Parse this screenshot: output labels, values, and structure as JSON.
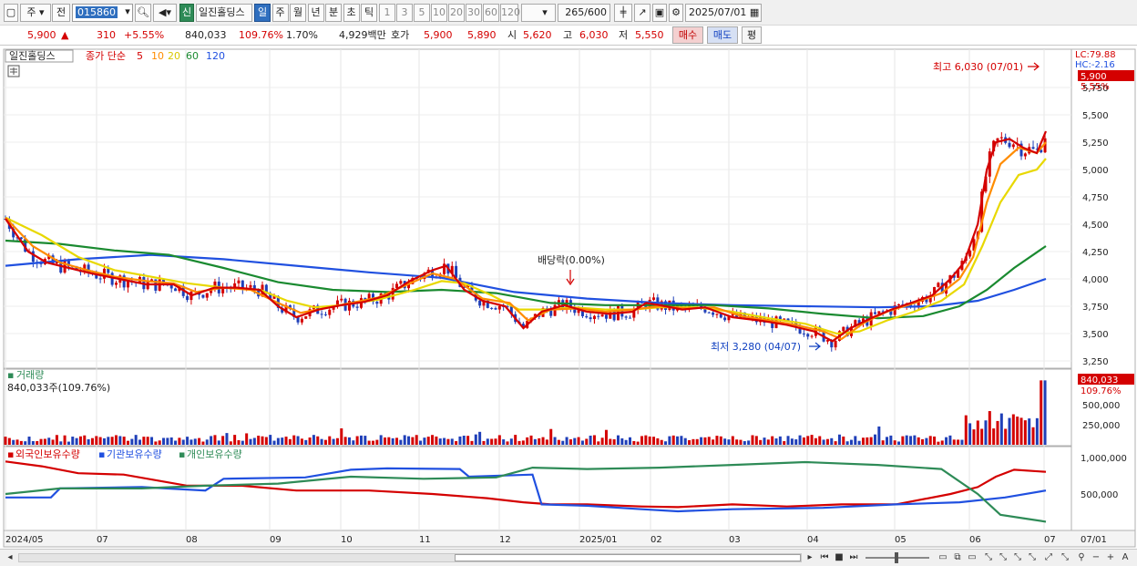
{
  "toolbar": {
    "type_label": "주",
    "prev_label": "전",
    "stock_code": "015860",
    "new_label": "신",
    "stock_name": "일진홀딩스",
    "period_tabs": [
      {
        "label": "일",
        "active": true
      },
      {
        "label": "주",
        "active": false
      },
      {
        "label": "월",
        "active": false
      },
      {
        "label": "년",
        "active": false
      },
      {
        "label": "분",
        "active": false
      },
      {
        "label": "초",
        "active": false
      },
      {
        "label": "틱",
        "active": false
      }
    ],
    "intervals": [
      "1",
      "3",
      "5",
      "10",
      "20",
      "30",
      "60",
      "120"
    ],
    "count": "265",
    "count_total": "/600",
    "date": "2025/07/01"
  },
  "quote": {
    "price": "5,900",
    "change": "310",
    "change_pct": "+5.55%",
    "volume": "840,033",
    "volume_ratio": "109.76%",
    "turnover": "1.70%",
    "amount": "4,929백만",
    "bid_label": "호가",
    "ask_price": "5,900",
    "bid_price": "5,890",
    "open_label": "시",
    "open": "5,620",
    "high_label": "고",
    "high": "6,030",
    "low_label": "저",
    "low": "5,550",
    "buy_label": "매수",
    "sell_label": "매도",
    "eval_label": "평"
  },
  "price_panel": {
    "stock_label": "일진홀딩스",
    "indicator_label": "종가 단순",
    "ma_periods": [
      "5",
      "10",
      "20",
      "60",
      "120"
    ],
    "ma_colors": [
      "#d40000",
      "#ff8c00",
      "#e8d800",
      "#1a8a30",
      "#2050e0"
    ],
    "lc_label": "LC:79.88",
    "hc_label": "HC:-2.16",
    "price_tag": "5,900",
    "pct_tag": "5.55%",
    "y_ticks": [
      "5,750",
      "5,500",
      "5,250",
      "5,000",
      "4,750",
      "4,500",
      "4,250",
      "4,000",
      "3,750",
      "3,500",
      "3,250"
    ],
    "high_annotation": "최고 6,030 (07/01)",
    "low_annotation": "최저 3,280 (04/07)",
    "dividend_annotation": "배당락(0.00%)"
  },
  "volume_panel": {
    "title": "거래량",
    "value_label": "840,033주(109.76%)",
    "tag": "840,033",
    "tag_pct": "109.76%",
    "y_ticks": [
      "500,000",
      "250,000"
    ]
  },
  "holdings_panel": {
    "series": [
      {
        "name": "외국인보유수량",
        "color": "#d40000"
      },
      {
        "name": "기관보유수량",
        "color": "#2050e0"
      },
      {
        "name": "개인보유수량",
        "color": "#2e8b57"
      }
    ],
    "y_ticks": [
      "1,000,000",
      "500,000"
    ]
  },
  "x_axis": {
    "labels": [
      "2024/05",
      "07",
      "08",
      "09",
      "10",
      "11",
      "12",
      "2025/01",
      "02",
      "03",
      "04",
      "05",
      "06",
      "07"
    ],
    "right_label": "07/01"
  },
  "chart_data": {
    "type": "line",
    "x_labels": [
      "2024/05",
      "07",
      "08",
      "09",
      "10",
      "11",
      "12",
      "2025/01",
      "02",
      "03",
      "04",
      "05",
      "06",
      "07"
    ],
    "price_ylim": [
      3200,
      6050
    ],
    "price_series": [
      {
        "name": "5",
        "color": "#d40000",
        "values": [
          [
            0,
            4550
          ],
          [
            25,
            4250
          ],
          [
            45,
            4150
          ],
          [
            70,
            4100
          ],
          [
            95,
            4050
          ],
          [
            125,
            4000
          ],
          [
            155,
            3950
          ],
          [
            185,
            3950
          ],
          [
            205,
            3850
          ],
          [
            230,
            3920
          ],
          [
            255,
            3920
          ],
          [
            280,
            3900
          ],
          [
            300,
            3750
          ],
          [
            320,
            3650
          ],
          [
            345,
            3720
          ],
          [
            370,
            3760
          ],
          [
            395,
            3790
          ],
          [
            420,
            3850
          ],
          [
            445,
            3980
          ],
          [
            470,
            4080
          ],
          [
            485,
            4120
          ],
          [
            505,
            3900
          ],
          [
            525,
            3800
          ],
          [
            550,
            3750
          ],
          [
            570,
            3550
          ],
          [
            590,
            3700
          ],
          [
            615,
            3760
          ],
          [
            640,
            3700
          ],
          [
            665,
            3680
          ],
          [
            690,
            3700
          ],
          [
            705,
            3780
          ],
          [
            720,
            3760
          ],
          [
            745,
            3720
          ],
          [
            770,
            3740
          ],
          [
            800,
            3650
          ],
          [
            830,
            3620
          ],
          [
            860,
            3580
          ],
          [
            890,
            3520
          ],
          [
            910,
            3430
          ],
          [
            930,
            3550
          ],
          [
            955,
            3650
          ],
          [
            975,
            3720
          ],
          [
            1000,
            3790
          ],
          [
            1020,
            3850
          ],
          [
            1040,
            4000
          ],
          [
            1055,
            4150
          ],
          [
            1070,
            4500
          ],
          [
            1080,
            5000
          ],
          [
            1090,
            5250
          ],
          [
            1105,
            5280
          ],
          [
            1120,
            5200
          ],
          [
            1135,
            5150
          ],
          [
            1145,
            5350
          ]
        ]
      },
      {
        "name": "10",
        "color": "#ff8c00",
        "values": [
          [
            0,
            4560
          ],
          [
            30,
            4300
          ],
          [
            60,
            4150
          ],
          [
            90,
            4080
          ],
          [
            120,
            4020
          ],
          [
            155,
            3980
          ],
          [
            185,
            3960
          ],
          [
            210,
            3880
          ],
          [
            240,
            3920
          ],
          [
            270,
            3900
          ],
          [
            300,
            3780
          ],
          [
            325,
            3690
          ],
          [
            350,
            3730
          ],
          [
            380,
            3780
          ],
          [
            410,
            3830
          ],
          [
            440,
            3940
          ],
          [
            470,
            4050
          ],
          [
            495,
            4000
          ],
          [
            525,
            3820
          ],
          [
            555,
            3780
          ],
          [
            575,
            3620
          ],
          [
            600,
            3720
          ],
          [
            630,
            3730
          ],
          [
            660,
            3700
          ],
          [
            690,
            3720
          ],
          [
            720,
            3750
          ],
          [
            750,
            3730
          ],
          [
            780,
            3740
          ],
          [
            810,
            3660
          ],
          [
            840,
            3620
          ],
          [
            870,
            3580
          ],
          [
            900,
            3520
          ],
          [
            920,
            3450
          ],
          [
            945,
            3600
          ],
          [
            970,
            3700
          ],
          [
            1000,
            3780
          ],
          [
            1030,
            3870
          ],
          [
            1050,
            4000
          ],
          [
            1065,
            4200
          ],
          [
            1080,
            4700
          ],
          [
            1095,
            5050
          ],
          [
            1115,
            5200
          ],
          [
            1135,
            5150
          ],
          [
            1145,
            5250
          ]
        ]
      },
      {
        "name": "20",
        "color": "#e8d800",
        "values": [
          [
            0,
            4560
          ],
          [
            40,
            4400
          ],
          [
            80,
            4200
          ],
          [
            120,
            4080
          ],
          [
            160,
            4020
          ],
          [
            200,
            3960
          ],
          [
            240,
            3920
          ],
          [
            280,
            3900
          ],
          [
            310,
            3800
          ],
          [
            340,
            3740
          ],
          [
            370,
            3760
          ],
          [
            410,
            3810
          ],
          [
            450,
            3900
          ],
          [
            480,
            3980
          ],
          [
            505,
            3960
          ],
          [
            535,
            3850
          ],
          [
            565,
            3720
          ],
          [
            595,
            3720
          ],
          [
            625,
            3740
          ],
          [
            660,
            3720
          ],
          [
            690,
            3720
          ],
          [
            720,
            3740
          ],
          [
            760,
            3740
          ],
          [
            800,
            3700
          ],
          [
            840,
            3640
          ],
          [
            880,
            3590
          ],
          [
            915,
            3500
          ],
          [
            940,
            3520
          ],
          [
            970,
            3620
          ],
          [
            1000,
            3700
          ],
          [
            1030,
            3800
          ],
          [
            1055,
            3950
          ],
          [
            1075,
            4300
          ],
          [
            1095,
            4700
          ],
          [
            1115,
            4950
          ],
          [
            1135,
            5000
          ],
          [
            1145,
            5100
          ]
        ]
      },
      {
        "name": "60",
        "color": "#1a8a30",
        "values": [
          [
            0,
            4350
          ],
          [
            60,
            4320
          ],
          [
            120,
            4260
          ],
          [
            180,
            4220
          ],
          [
            240,
            4100
          ],
          [
            300,
            3970
          ],
          [
            360,
            3900
          ],
          [
            420,
            3880
          ],
          [
            480,
            3900
          ],
          [
            540,
            3870
          ],
          [
            600,
            3780
          ],
          [
            660,
            3760
          ],
          [
            720,
            3760
          ],
          [
            780,
            3760
          ],
          [
            840,
            3730
          ],
          [
            900,
            3680
          ],
          [
            960,
            3640
          ],
          [
            1010,
            3660
          ],
          [
            1050,
            3750
          ],
          [
            1080,
            3900
          ],
          [
            1110,
            4100
          ],
          [
            1145,
            4300
          ]
        ]
      },
      {
        "name": "120",
        "color": "#2050e0",
        "values": [
          [
            0,
            4120
          ],
          [
            80,
            4180
          ],
          [
            160,
            4220
          ],
          [
            240,
            4180
          ],
          [
            320,
            4120
          ],
          [
            400,
            4060
          ],
          [
            480,
            4010
          ],
          [
            560,
            3880
          ],
          [
            640,
            3820
          ],
          [
            720,
            3780
          ],
          [
            800,
            3760
          ],
          [
            880,
            3750
          ],
          [
            960,
            3740
          ],
          [
            1020,
            3750
          ],
          [
            1070,
            3800
          ],
          [
            1110,
            3900
          ],
          [
            1145,
            4000
          ]
        ]
      }
    ],
    "volume_ylim": [
      0,
      880000
    ],
    "holdings_series": [
      {
        "name": "외국인보유수량",
        "color": "#d40000",
        "values": [
          [
            0,
            0.97
          ],
          [
            40,
            0.9
          ],
          [
            80,
            0.8
          ],
          [
            130,
            0.78
          ],
          [
            200,
            0.62
          ],
          [
            260,
            0.62
          ],
          [
            320,
            0.55
          ],
          [
            400,
            0.55
          ],
          [
            470,
            0.5
          ],
          [
            530,
            0.44
          ],
          [
            570,
            0.38
          ],
          [
            600,
            0.35
          ],
          [
            640,
            0.35
          ],
          [
            700,
            0.32
          ],
          [
            740,
            0.31
          ],
          [
            800,
            0.35
          ],
          [
            860,
            0.32
          ],
          [
            920,
            0.35
          ],
          [
            980,
            0.35
          ],
          [
            1040,
            0.5
          ],
          [
            1070,
            0.6
          ],
          [
            1090,
            0.75
          ],
          [
            1110,
            0.85
          ],
          [
            1145,
            0.82
          ]
        ]
      },
      {
        "name": "기관보유수량",
        "color": "#2050e0",
        "values": [
          [
            0,
            0.45
          ],
          [
            50,
            0.45
          ],
          [
            60,
            0.58
          ],
          [
            150,
            0.6
          ],
          [
            220,
            0.55
          ],
          [
            240,
            0.72
          ],
          [
            330,
            0.74
          ],
          [
            380,
            0.85
          ],
          [
            420,
            0.87
          ],
          [
            500,
            0.86
          ],
          [
            510,
            0.75
          ],
          [
            580,
            0.78
          ],
          [
            590,
            0.35
          ],
          [
            640,
            0.33
          ],
          [
            700,
            0.28
          ],
          [
            740,
            0.25
          ],
          [
            800,
            0.28
          ],
          [
            900,
            0.3
          ],
          [
            980,
            0.35
          ],
          [
            1050,
            0.38
          ],
          [
            1100,
            0.45
          ],
          [
            1145,
            0.55
          ]
        ]
      },
      {
        "name": "개인보유수량",
        "color": "#2e8b57",
        "values": [
          [
            0,
            0.5
          ],
          [
            60,
            0.58
          ],
          [
            150,
            0.58
          ],
          [
            220,
            0.62
          ],
          [
            300,
            0.65
          ],
          [
            380,
            0.75
          ],
          [
            460,
            0.72
          ],
          [
            540,
            0.74
          ],
          [
            580,
            0.88
          ],
          [
            640,
            0.86
          ],
          [
            720,
            0.88
          ],
          [
            800,
            0.92
          ],
          [
            880,
            0.96
          ],
          [
            960,
            0.92
          ],
          [
            1030,
            0.86
          ],
          [
            1070,
            0.5
          ],
          [
            1095,
            0.2
          ],
          [
            1120,
            0.15
          ],
          [
            1145,
            0.1
          ]
        ]
      }
    ]
  }
}
